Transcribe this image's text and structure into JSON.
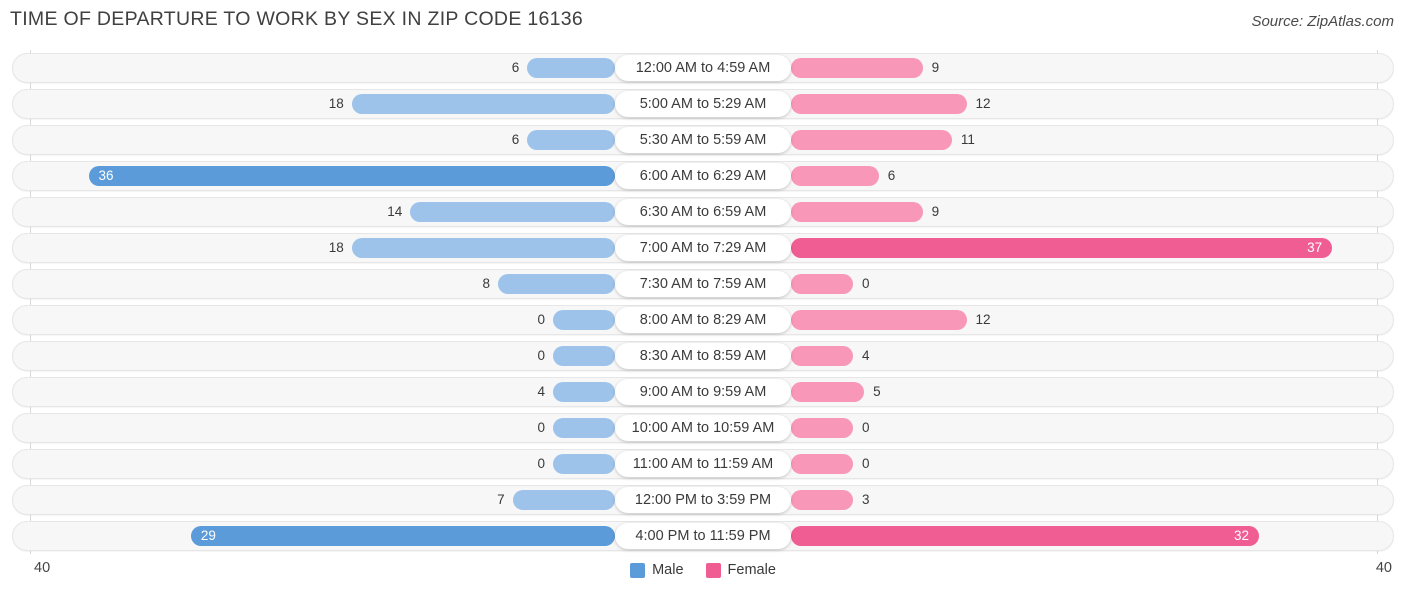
{
  "header": {
    "title": "TIME OF DEPARTURE TO WORK BY SEX IN ZIP CODE 16136",
    "source": "Source: ZipAtlas.com"
  },
  "legend": {
    "items": [
      {
        "label": "Male",
        "color": "#5B9BD9"
      },
      {
        "label": "Female",
        "color": "#EF5D92"
      }
    ]
  },
  "axis": {
    "left_max": "40",
    "right_max": "40"
  },
  "colors": {
    "male_light": "#9DC3EA",
    "male_strong": "#5B9BD9",
    "female_light": "#F897B8",
    "female_strong": "#EF5D92",
    "track": "#F7F7F7",
    "track_border": "#E6E6E6"
  },
  "chart_data": {
    "type": "bar",
    "subtype": "diverging-bar",
    "title": "TIME OF DEPARTURE TO WORK BY SEX IN ZIP CODE 16136",
    "xlabel": "",
    "ylabel": "",
    "xlim": [
      40,
      40
    ],
    "grid": false,
    "legend_position": "bottom-center",
    "categories": [
      "12:00 AM to 4:59 AM",
      "5:00 AM to 5:29 AM",
      "5:30 AM to 5:59 AM",
      "6:00 AM to 6:29 AM",
      "6:30 AM to 6:59 AM",
      "7:00 AM to 7:29 AM",
      "7:30 AM to 7:59 AM",
      "8:00 AM to 8:29 AM",
      "8:30 AM to 8:59 AM",
      "9:00 AM to 9:59 AM",
      "10:00 AM to 10:59 AM",
      "11:00 AM to 11:59 AM",
      "12:00 PM to 3:59 PM",
      "4:00 PM to 11:59 PM"
    ],
    "series": [
      {
        "name": "Male",
        "direction": "left",
        "color": "#5B9BD9",
        "values": [
          6,
          18,
          6,
          36,
          14,
          18,
          8,
          0,
          0,
          4,
          0,
          0,
          7,
          29
        ]
      },
      {
        "name": "Female",
        "direction": "right",
        "color": "#EF5D92",
        "values": [
          9,
          12,
          11,
          6,
          9,
          37,
          0,
          12,
          4,
          5,
          0,
          0,
          3,
          32
        ]
      }
    ]
  }
}
